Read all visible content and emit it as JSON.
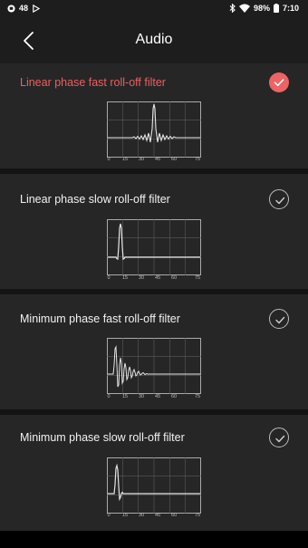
{
  "status_bar": {
    "notification_count": "48",
    "battery_level": "98%",
    "time": "7:10",
    "icons": [
      "notification-icon",
      "play-icon",
      "bluetooth-icon",
      "wifi-icon",
      "battery-icon"
    ]
  },
  "header": {
    "title": "Audio",
    "back_icon": "chevron-left-icon"
  },
  "filters": [
    {
      "label": "Linear phase fast roll-off filter",
      "selected": true
    },
    {
      "label": "Linear phase slow roll-off filter",
      "selected": false
    },
    {
      "label": "Minimum phase fast roll-off filter",
      "selected": false
    },
    {
      "label": "Minimum phase slow roll-off filter",
      "selected": false
    }
  ],
  "graph_ticks": [
    "0",
    "15",
    "30",
    "45",
    "60",
    "75"
  ],
  "colors": {
    "accent": "#ee6363",
    "background": "#1d1d1d",
    "card": "#262626"
  }
}
